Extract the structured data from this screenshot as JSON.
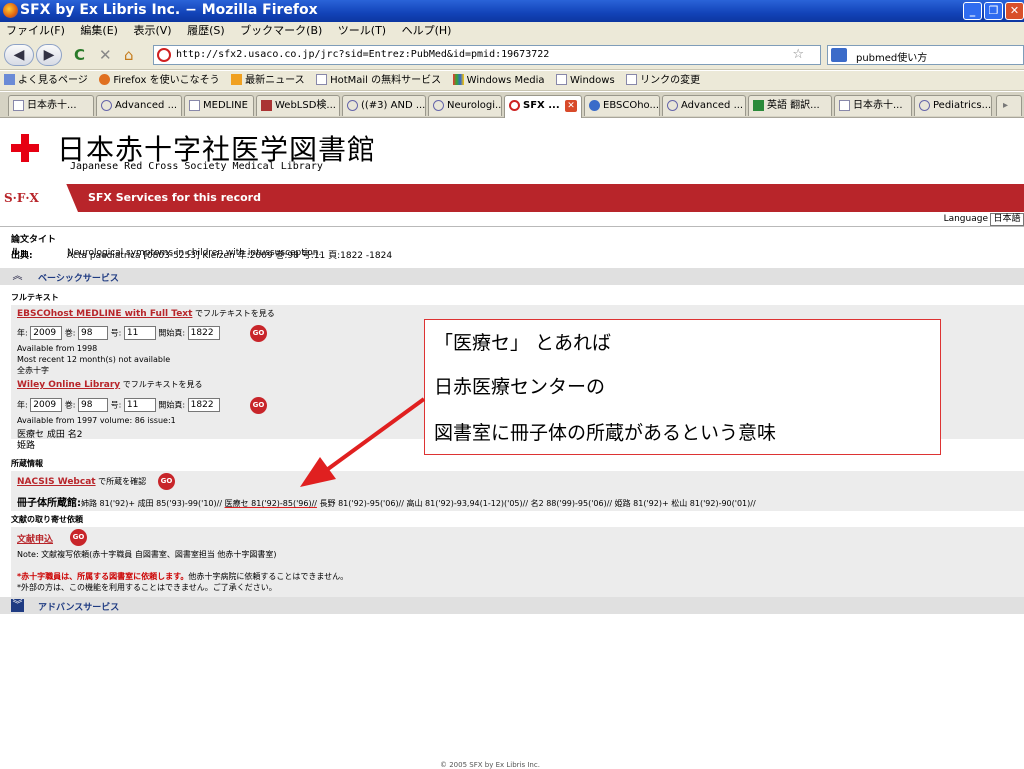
{
  "window": {
    "title": "SFX by Ex Libris Inc. − Mozilla Firefox",
    "controls": [
      "_",
      "❐",
      "✕"
    ]
  },
  "menu": [
    "ファイル(F)",
    "編集(E)",
    "表示(V)",
    "履歴(S)",
    "ブックマーク(B)",
    "ツール(T)",
    "ヘルプ(H)"
  ],
  "nav": {
    "url": "http://sfx2.usaco.co.jp/jrc?sid=Entrez:PubMed&id=pmid:19673722",
    "search_value": "pubmed使い方"
  },
  "bookmarks": [
    "よく見るページ",
    "Firefox を使いこなそう",
    "最新ニュース",
    "HotMail の無料サービス",
    "Windows Media",
    "Windows",
    "リンクの変更"
  ],
  "tabs": [
    {
      "label": "日本赤十..."
    },
    {
      "label": "Advanced ..."
    },
    {
      "label": "MEDLINE"
    },
    {
      "label": "WebLSD検..."
    },
    {
      "label": "((#3) AND ..."
    },
    {
      "label": "Neurologi..."
    },
    {
      "label": "SFX ..."
    },
    {
      "label": "EBSCOho..."
    },
    {
      "label": "Advanced ..."
    },
    {
      "label": "英語 翻訳..."
    },
    {
      "label": "日本赤十..."
    },
    {
      "label": "Pediatrics..."
    }
  ],
  "page": {
    "library_name": "日本赤十字社医学図書館",
    "library_name_en": "Japanese Red Cross Society Medical Library",
    "sfx_logo": "S·F·X",
    "sfx_services": "SFX Services for this record",
    "language_label": "Language",
    "language_value": "日本語",
    "article_title_label": "論文タイトル:",
    "article_title": "Neurological symptoms in children with intussusception.",
    "source_label": "出典:",
    "source": "Acta paediatrica [0803-5253] Kleizen 年:2009 巻:98 号:11 頁:1822 -1824",
    "basic_services": "ベーシックサービス",
    "fulltext_heading": "フルテキスト",
    "ebsco_link": "EBSCOhost MEDLINE with Full Text",
    "view_fulltext": "でフルテキストを見る",
    "year_label": "年:",
    "year": "2009",
    "volume_label": "巻:",
    "volume": "98",
    "issue_label": "号:",
    "issue": "11",
    "start_page_label": "開始頁:",
    "start_page": "1822",
    "go": "GO",
    "ebsco_avail1": "Available from 1998",
    "ebsco_avail2": "Most recent 12 month(s) not available",
    "ebsco_avail3": "全赤十字",
    "wiley_link": "Wiley Online Library",
    "wiley_avail": "Available from 1997 volume: 86 issue:1",
    "wiley_hold1": "医療セ 成田 名2",
    "wiley_hold2": "姫路",
    "holdings_heading": "所蔵情報",
    "nacsis_link": "NACSIS Webcat",
    "nacsis_check": "で所蔵を確認",
    "holdings_label": "冊子体所蔵館:",
    "holdings_pre": "姉路 81('92)+ 成田 85('93)-99('10)//",
    "holdings_highlight": "医療セ 81('92)-85('96)//",
    "holdings_post": "長野 81('92)-95('06)// 高山 81('92)-93,94(1-12)('05)// 名2 88('99)-95('06)// 姫路 81('92)+ 松山 81('92)-90('01)//",
    "docdelivery_heading": "文献の取り寄せ依頼",
    "request_link": "文献申込",
    "note": "Note: 文献複写依頼(赤十字職員 自図書室、図書室担当 他赤十字図書室)",
    "warning_red": "*赤十字職員は、所属する図書室に依頼します。",
    "warning_rest": "他赤十字病院に依頼することはできません。",
    "warning2": "*外部の方は、この機能を利用することはできません。ご了承ください。",
    "advanced_services": "アドバンスサービス",
    "footer": "© 2005 SFX by Ex Libris Inc."
  },
  "callout": {
    "line1": "「医療セ」 とあれば",
    "line2": "日赤医療センターの",
    "line3": "図書室に冊子体の所蔵があるという意味"
  },
  "colors": {
    "sfx_red": "#b8252a",
    "cross_red": "#e60012",
    "arrow_red": "#e02020"
  }
}
